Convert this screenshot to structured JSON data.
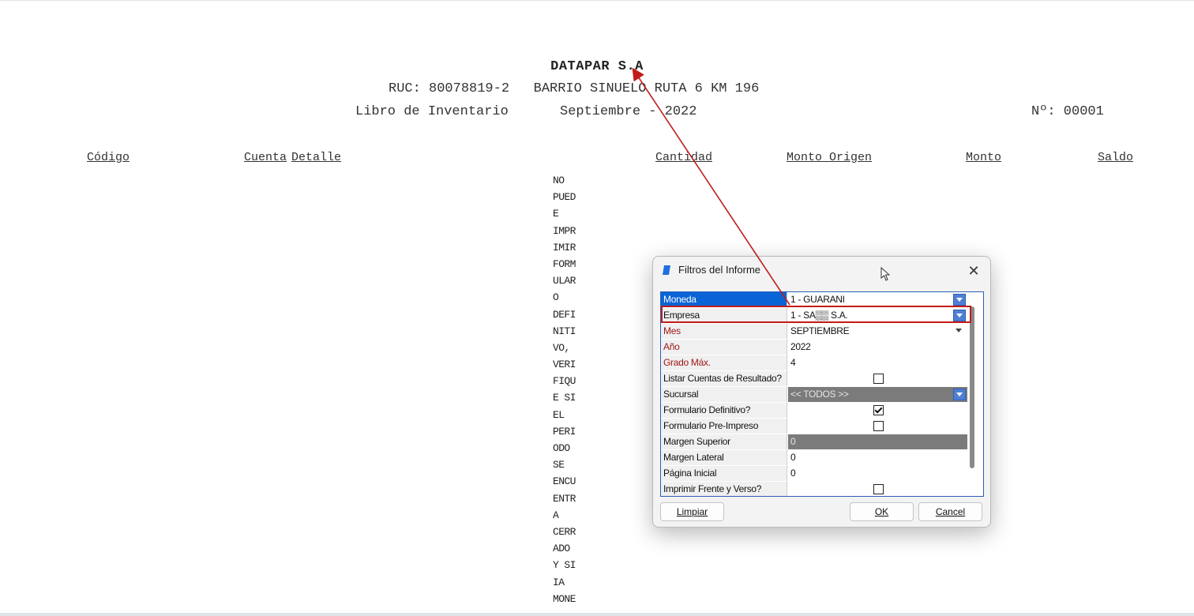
{
  "report": {
    "company": "DATAPAR S.A",
    "ruc_line": "RUC: 80078819-2   BARRIO SINUELO RUTA 6 KM 196",
    "book_title": "Libro de Inventario",
    "period": "Septiembre - 2022",
    "number": "Nº: 00001",
    "columns": [
      "Código",
      "Cuenta",
      "Detalle",
      "Cantidad",
      "Monto Origen",
      "Monto",
      "Saldo"
    ],
    "warning_lines": [
      "NO",
      "PUED",
      "E",
      "IMPR",
      "IMIR",
      "FORM",
      "ULAR",
      "O",
      "DEFI",
      "NITI",
      "VO,",
      "VERI",
      "FIQU",
      "E SI",
      "EL",
      "PERI",
      "ODO",
      "SE",
      "ENCU",
      "ENTR",
      "A",
      "CERR",
      "ADO",
      "Y SI",
      "IA",
      "MONE"
    ]
  },
  "dialog": {
    "title": "Filtros del Informe",
    "close_label": "✕",
    "fields": [
      {
        "label": "Moneda",
        "value": "1 - GUARANI"
      },
      {
        "label": "Empresa",
        "value": "1 - SA▒▒ S.A."
      },
      {
        "label": "Mes",
        "value": "SEPTIEMBRE"
      },
      {
        "label": "Año",
        "value": "2022"
      },
      {
        "label": "Grado Máx.",
        "value": "4"
      },
      {
        "label": "Listar Cuentas de Resultado?",
        "value": ""
      },
      {
        "label": "Sucursal",
        "value": "<< TODOS >>"
      },
      {
        "label": "Formulario Definitivo?",
        "value": ""
      },
      {
        "label": "Formulario Pre-Impreso",
        "value": ""
      },
      {
        "label": "Margen Superior",
        "value": "0"
      },
      {
        "label": "Margen Lateral",
        "value": "0"
      },
      {
        "label": "Página Inicial",
        "value": "0"
      },
      {
        "label": "Imprimir Frente y Verso?",
        "value": ""
      }
    ],
    "buttons": {
      "clear": "Limpiar",
      "ok": "OK",
      "cancel": "Cancel"
    }
  },
  "colors": {
    "accent": "#0a64d6",
    "annotation": "#c21b1b",
    "required_label": "#a0181a"
  }
}
